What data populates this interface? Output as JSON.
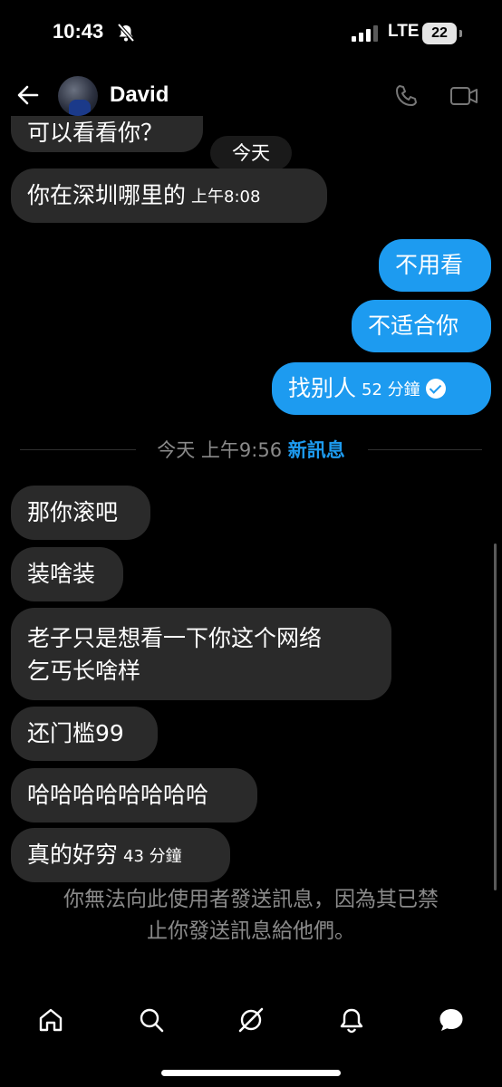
{
  "status": {
    "time": "10:43",
    "network": "LTE",
    "battery": "22"
  },
  "header": {
    "contact_name": "David"
  },
  "messages_top": [
    {
      "text": "可以看看你？"
    },
    {
      "text": "你在深圳哪里的",
      "time": "上午8:08"
    }
  ],
  "date_divider": "今天",
  "messages_out": [
    {
      "text": "不用看"
    },
    {
      "text": "不适合你"
    },
    {
      "text": "找别人",
      "time": "52 分鐘"
    }
  ],
  "new_messages": {
    "date": "今天 上午9:56",
    "label": "新訊息"
  },
  "messages_new": [
    {
      "text": "那你滚吧"
    },
    {
      "text": "装啥装"
    },
    {
      "line1": "老子只是想看一下你这个网络",
      "line2": "乞丐长啥样"
    },
    {
      "text": "还门槛99"
    },
    {
      "text": "哈哈哈哈哈哈哈哈"
    },
    {
      "text": "真的好穷",
      "time": "43 分鐘"
    }
  ],
  "notice": {
    "line1": "你無法向此使用者發送訊息，因為其已禁",
    "line2": "止你發送訊息給他們。"
  },
  "nav_icons": [
    "home-icon",
    "search-icon",
    "grok-icon",
    "notifications-icon",
    "messages-icon"
  ]
}
